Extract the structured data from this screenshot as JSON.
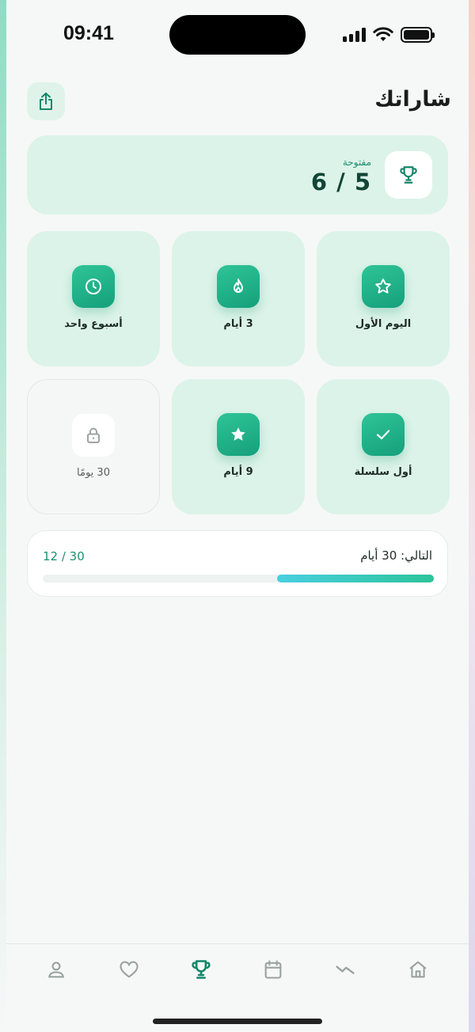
{
  "status_bar": {
    "time": "09:41"
  },
  "header": {
    "title": "شاراتك",
    "share_icon": "share-icon"
  },
  "summary": {
    "label": "مفتوحة",
    "count": "6 / 5",
    "icon": "trophy-icon"
  },
  "badges": [
    {
      "label": "اليوم الأول",
      "icon": "star-outline-icon",
      "locked": false
    },
    {
      "label": "3 أيام",
      "icon": "flame-icon",
      "locked": false
    },
    {
      "label": "أسبوع واحد",
      "icon": "clock-icon",
      "locked": false
    },
    {
      "label": "أول سلسلة",
      "icon": "check-icon",
      "locked": false
    },
    {
      "label": "9 أيام",
      "icon": "star-filled-icon",
      "locked": false
    },
    {
      "label": "30 يومًا",
      "icon": "lock-icon",
      "locked": true
    }
  ],
  "progress": {
    "label": "التالي: 30 أيام",
    "count": "12 / 30",
    "value": 12,
    "max": 30
  },
  "tab_bar": {
    "tabs": [
      {
        "icon": "home-icon",
        "active": false
      },
      {
        "icon": "trend-icon",
        "active": false
      },
      {
        "icon": "calendar-icon",
        "active": false
      },
      {
        "icon": "trophy-icon",
        "active": true
      },
      {
        "icon": "heart-icon",
        "active": false
      },
      {
        "icon": "profile-icon",
        "active": false
      }
    ]
  },
  "colors": {
    "accent": "#1a9e7a",
    "card_bg": "#dcf3e9",
    "page_bg": "#f6f8f7",
    "progress_start": "#49cfe0",
    "progress_end": "#2cc49a"
  }
}
